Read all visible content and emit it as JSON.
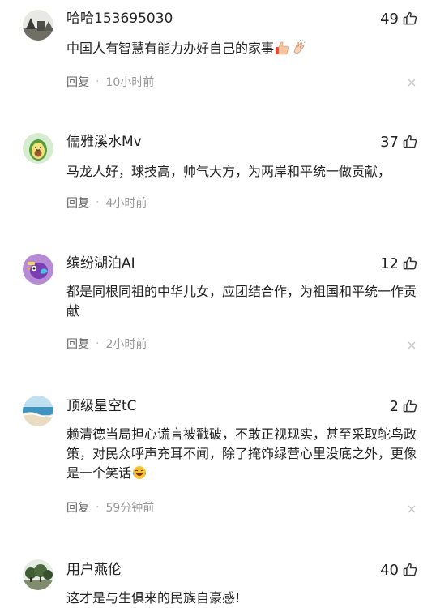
{
  "comments": [
    {
      "username": "哈哈153695030",
      "likes": "49",
      "content": "中国人有智慧有能力办好自己的家事",
      "emojis": [
        "thumbs-up-emoji",
        "clapping-hands-emoji"
      ],
      "reply_label": "回复",
      "separator": "·",
      "time": "10小时前",
      "avatar": "landscape-photo-avatar"
    },
    {
      "username": "儒雅溪水Mv",
      "likes": "37",
      "content": "马龙人好，球技高，帅气大方，为两岸和平统一做贡献，",
      "reply_label": "回复",
      "separator": "·",
      "time": "4小时前",
      "avatar": "avocado-cartoon-avatar"
    },
    {
      "username": "缤纷湖泊AI",
      "likes": "12",
      "content": "都是同根同祖的中华儿女，应团结合作，为祖国和平统一作贡献",
      "reply_label": "回复",
      "separator": "·",
      "time": "2小时前",
      "avatar": "purple-bird-cartoon-avatar"
    },
    {
      "username": "顶级星空tC",
      "likes": "2",
      "content": "赖清德当局担心谎言被戳破，不敢正视现实，甚至采取鸵鸟政策，对民众呼声充耳不闻，除了掩饰绿营心里没底之外，更像是一个笑话",
      "emojis": [
        "laughing-tears-emoji"
      ],
      "reply_label": "回复",
      "separator": "·",
      "time": "59分钟前",
      "avatar": "beach-photo-avatar"
    },
    {
      "username": "用户燕伦",
      "likes": "40",
      "content": "这才是与生俱来的民族自豪感!",
      "avatar": "trees-photo-avatar"
    }
  ],
  "colors": {
    "text_primary": "#222222",
    "text_meta": "#999999",
    "background": "#ffffff"
  },
  "icons": {
    "like": "thumbs-up-outline-icon",
    "dismiss": "close-icon"
  }
}
